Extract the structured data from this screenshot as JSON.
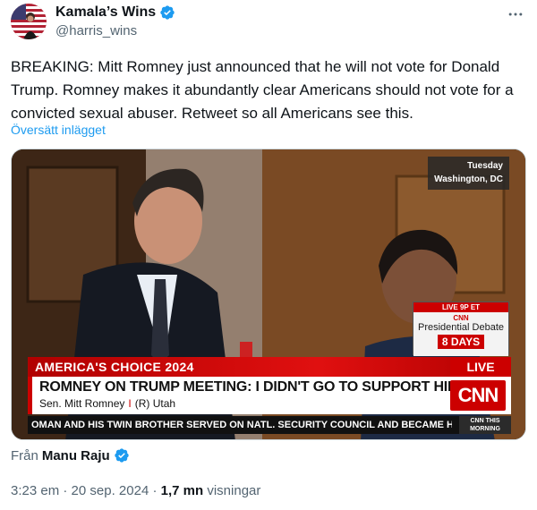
{
  "author": {
    "display_name": "Kamala’s Wins",
    "handle": "@harris_wins",
    "verified": true
  },
  "icons": {
    "verified": "verified-badge-icon",
    "more": "more-options-icon"
  },
  "tweet": {
    "text": "BREAKING: Mitt Romney just announced that he will not vote for Donald Trump. Romney makes it abundantly clear Americans should not vote for a convicted sexual abuser. Retweet so all Americans see this.",
    "translate_label": "Översätt inlägget"
  },
  "video": {
    "bug_day": "Tuesday",
    "bug_location": "Washington, DC",
    "promo_live": "LIVE 9P ET",
    "promo_logo": "CNN",
    "promo_title": "Presidential Debate",
    "promo_days": "8 DAYS",
    "banner_label": "AMERICA'S CHOICE 2024",
    "live_label": "LIVE",
    "headline": "ROMNEY ON TRUMP MEETING: I DIDN'T GO TO SUPPORT HIM",
    "subject_name": "Sen. Mitt Romney",
    "subject_separator": "I",
    "subject_party": "(R) Utah",
    "logo": "CNN",
    "ticker": "OMAN AND HIS TWIN BROTHER SERVED ON NATL. SECURITY COUNCIL AND BECAME HER",
    "show_line1": "CNN THIS",
    "show_line2": "MORNING"
  },
  "attribution": {
    "prefix": "Från",
    "source": "Manu Raju"
  },
  "meta": {
    "time": "3:23 em",
    "separator": "·",
    "date": "20 sep. 2024",
    "views_count": "1,7 mn",
    "views_label": "visningar"
  },
  "colors": {
    "accent": "#1d9bf0",
    "cnn_red": "#cc0000",
    "text_primary": "#0f1419",
    "text_secondary": "#536471"
  }
}
